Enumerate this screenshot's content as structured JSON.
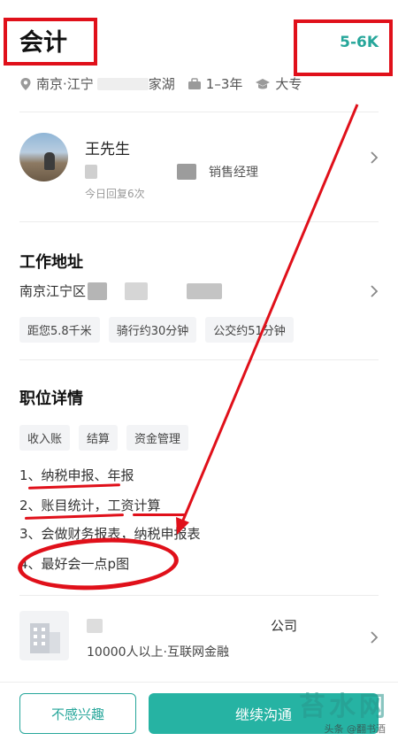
{
  "header": {
    "job_title": "会计",
    "salary": "5-6K",
    "location": "南京·江宁",
    "district": "家湖",
    "experience": "1–3年",
    "education": "大专"
  },
  "recruiter": {
    "name": "王先生",
    "role": "销售经理",
    "reply_note": "今日回复6次"
  },
  "work_address": {
    "title": "工作地址",
    "address": "南京江宁区",
    "tags": [
      "距您5.8千米",
      "骑行约30分钟",
      "公交约51分钟"
    ]
  },
  "job_detail": {
    "title": "职位详情",
    "tags": [
      "收入账",
      "结算",
      "资金管理"
    ],
    "lines": [
      "1、纳税申报、年报",
      "2、账目统计，工资计算",
      "3、会做财务报表，纳税申报表",
      "4、最好会一点p图"
    ]
  },
  "company": {
    "name_suffix": "公司",
    "info": "10000人以上·互联网金融"
  },
  "actions": {
    "not_interested": "不感兴趣",
    "continue_chat": "继续沟通"
  },
  "watermark": {
    "logo_text": "苔水网",
    "source": "头条 @翻书酒"
  },
  "colors": {
    "accent": "#26a69a",
    "annotation_red": "#e0101a"
  }
}
